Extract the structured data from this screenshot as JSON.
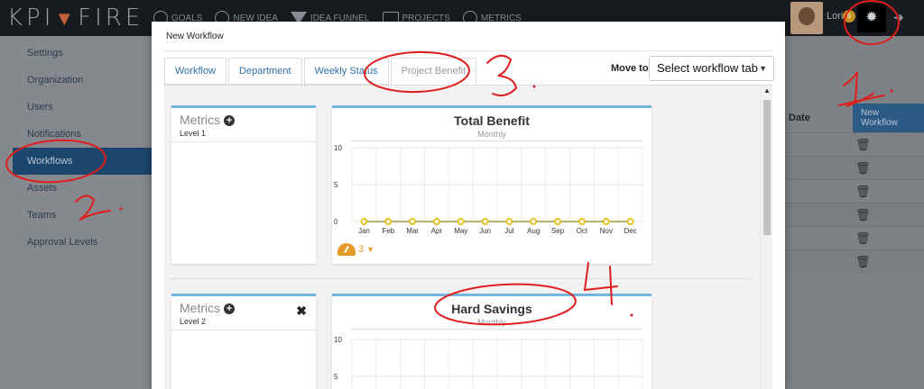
{
  "app": {
    "logo_text": "KPI FIRE",
    "nav": [
      {
        "label": "GOALS",
        "icon": "target-icon"
      },
      {
        "label": "NEW IDEA",
        "icon": "lightbulb-icon"
      },
      {
        "label": "IDEA FUNNEL",
        "icon": "funnel-icon"
      },
      {
        "label": "PROJECTS",
        "icon": "projects-icon"
      },
      {
        "label": "METRICS",
        "icon": "gauge-icon"
      }
    ],
    "user": {
      "name": "Lori",
      "notifications": "5"
    }
  },
  "sidebar": {
    "items": [
      {
        "label": "Settings"
      },
      {
        "label": "Organization"
      },
      {
        "label": "Users"
      },
      {
        "label": "Notifications"
      },
      {
        "label": "Workflows",
        "active": true
      },
      {
        "label": "Assets"
      },
      {
        "label": "Teams"
      },
      {
        "label": "Approval Levels"
      }
    ]
  },
  "background_table": {
    "date_header": "Date",
    "new_workflow_button": "New Workflow",
    "row_count": 6
  },
  "modal": {
    "title": "New Workflow",
    "tabs": [
      {
        "label": "Workflow"
      },
      {
        "label": "Department"
      },
      {
        "label": "Weekly Status"
      },
      {
        "label": "Project Benefit",
        "active": true
      }
    ],
    "move_to_label": "Move to",
    "select_value": "Select workflow tab",
    "sections": [
      {
        "metrics_title": "Metrics",
        "level": "Level 1",
        "chart_title": "Total Benefit",
        "chart_subtitle": "Monthly",
        "status_count": "3"
      },
      {
        "metrics_title": "Metrics",
        "level": "Level 2",
        "chart_title": "Hard Savings",
        "chart_subtitle": "Monthly"
      }
    ]
  },
  "chart_data": [
    {
      "type": "line",
      "title": "Total Benefit",
      "subtitle": "Monthly",
      "categories": [
        "Jan",
        "Feb",
        "Mar",
        "Apr",
        "May",
        "Jun",
        "Jul",
        "Aug",
        "Sep",
        "Oct",
        "Nov",
        "Dec"
      ],
      "values": [
        0,
        0,
        0,
        0,
        0,
        0,
        0,
        0,
        0,
        0,
        0,
        0
      ],
      "yticks": [
        0,
        5,
        10
      ],
      "ylim": [
        0,
        10
      ],
      "color": "#e8c21f",
      "grid": true
    },
    {
      "type": "line",
      "title": "Hard Savings",
      "subtitle": "Monthly",
      "yticks": [
        5,
        10
      ],
      "ylim": [
        0,
        10
      ],
      "grid": true
    }
  ],
  "annotations": [
    "1",
    "2",
    "3",
    "4"
  ],
  "colors": {
    "annotation": "#e11c1c",
    "accent": "#70b6e0",
    "link": "#2f6fa6"
  }
}
